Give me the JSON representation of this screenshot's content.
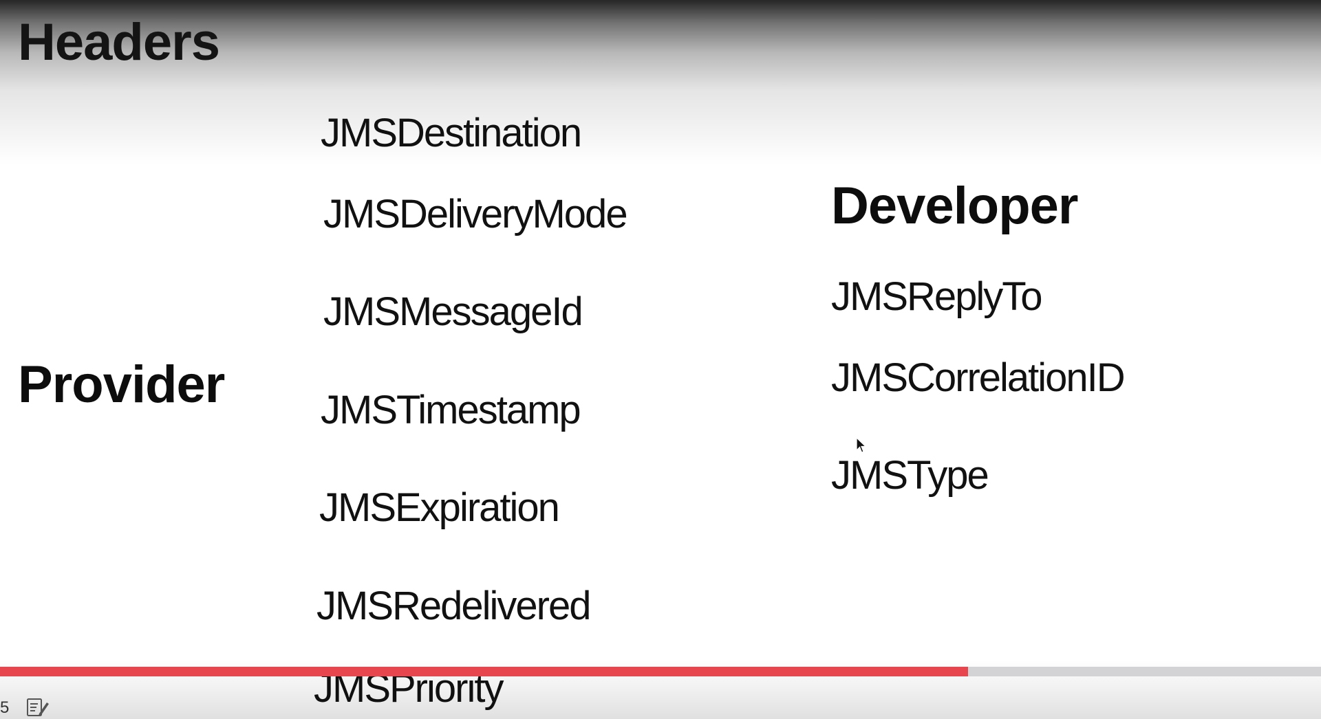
{
  "slide": {
    "title": "Headers",
    "provider": {
      "label": "Provider",
      "headers": [
        "JMSDestination",
        "JMSDeliveryMode",
        "JMSMessageId",
        "JMSTimestamp",
        "JMSExpiration",
        "JMSRedelivered",
        "JMSPriority"
      ]
    },
    "developer": {
      "label": "Developer",
      "headers": [
        "JMSReplyTo",
        "JMSCorrelationID",
        "JMSType"
      ]
    }
  },
  "player": {
    "progress_fraction": 0.733,
    "time_fragment": "5",
    "notes_icon": "notes-icon",
    "played_color": "#e8464f",
    "track_color": "#d3d3d6"
  }
}
